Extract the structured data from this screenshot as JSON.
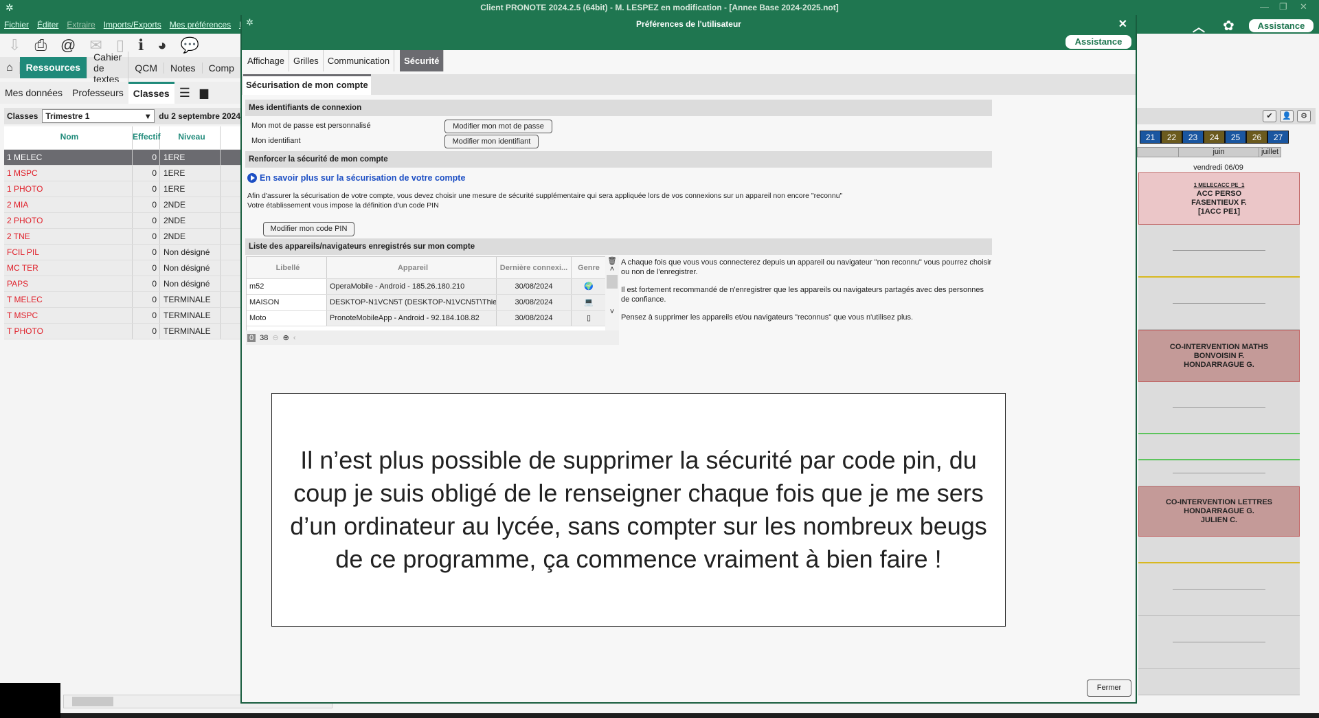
{
  "app": {
    "title": "Client PRONOTE 2024.2.5 (64bit) - M. LESPEZ en modification - [Annee Base 2024-2025.not]",
    "assistance": "Assistance",
    "menu": [
      {
        "label": "Fichier",
        "enabled": true
      },
      {
        "label": "Éditer",
        "enabled": true
      },
      {
        "label": "Extraire",
        "enabled": false
      },
      {
        "label": "Imports/Exports",
        "enabled": true
      },
      {
        "label": "Mes préférences",
        "enabled": true
      },
      {
        "label": "Pa",
        "enabled": true
      }
    ],
    "nav": [
      "Ressources",
      "Cahier de textes",
      "QCM",
      "Notes",
      "Comp"
    ],
    "subtabs": [
      "Mes données",
      "Professeurs",
      "Classes"
    ],
    "filter": {
      "label": "Classes",
      "period": "Trimestre 1",
      "date": "du 2 septembre 2024"
    },
    "class_table": {
      "headers": [
        "Nom",
        "Effectif",
        "Niveau"
      ],
      "rows": [
        [
          "1 MELEC",
          "0",
          "1ERE"
        ],
        [
          "1 MSPC",
          "0",
          "1ERE"
        ],
        [
          "1 PHOTO",
          "0",
          "1ERE"
        ],
        [
          "2 MIA",
          "0",
          "2NDE"
        ],
        [
          "2 PHOTO",
          "0",
          "2NDE"
        ],
        [
          "2 TNE",
          "0",
          "2NDE"
        ],
        [
          "FCIL PIL",
          "0",
          "Non désigné"
        ],
        [
          "MC TER",
          "0",
          "Non désigné"
        ],
        [
          "PAPS",
          "0",
          "Non désigné"
        ],
        [
          "T MELEC",
          "0",
          "TERMINALE"
        ],
        [
          "T MSPC",
          "0",
          "TERMINALE"
        ],
        [
          "T PHOTO",
          "0",
          "TERMINALE"
        ]
      ],
      "selected": 0
    }
  },
  "calendar": {
    "weeks": [
      {
        "n": "21",
        "color": "#1a56a0"
      },
      {
        "n": "22",
        "color": "#6b5a1e"
      },
      {
        "n": "23",
        "color": "#1a56a0"
      },
      {
        "n": "24",
        "color": "#6b5a1e"
      },
      {
        "n": "25",
        "color": "#1a56a0"
      },
      {
        "n": "26",
        "color": "#6b5a1e"
      },
      {
        "n": "27",
        "color": "#1a56a0"
      }
    ],
    "months": [
      "juin",
      "juillet"
    ],
    "day": "vendredi 06/09",
    "courses": [
      {
        "code": "1 MELECACC PE_1",
        "lines": [
          "ACC PERSO",
          "FASENTIEUX F.",
          "[1ACC PE1]"
        ]
      },
      {
        "lines": [
          "CO-INTERVENTION MATHS",
          "BONVOISIN F.",
          "HONDARRAGUE G."
        ]
      },
      {
        "lines": [
          "CO-INTERVENTION LETTRES",
          "HONDARRAGUE G.",
          "JULIEN C."
        ]
      }
    ]
  },
  "dialog": {
    "title": "Préférences de l'utilisateur",
    "assistance": "Assistance",
    "tabs": [
      "Affichage",
      "Grilles",
      "Communication",
      "Sécurité"
    ],
    "active_tab": "Sécurité",
    "section": "Sécurisation de mon compte",
    "identifiants": {
      "title": "Mes identifiants de connexion",
      "password_label": "Mon mot de passe est personnalisé",
      "password_button": "Modifier mon mot de passe",
      "id_label": "Mon identifiant",
      "id_button": "Modifier mon identifiant"
    },
    "renforcer": {
      "title": "Renforcer la sécurité de mon compte",
      "link": "En savoir plus sur la sécurisation de votre compte",
      "text1": "Afin d'assurer la sécurisation de votre compte, vous devez choisir une mesure de sécurité supplémentaire qui sera appliquée lors de vos connexions sur un appareil non encore \"reconnu\"",
      "text2": "Votre établissement vous impose la définition d'un code PIN",
      "pin_button": "Modifier mon code PIN"
    },
    "devices": {
      "title": "Liste des appareils/navigateurs enregistrés sur mon compte",
      "headers": [
        "Libellé",
        "Appareil",
        "Dernière connexi...",
        "Genre"
      ],
      "rows": [
        [
          "m52",
          "OperaMobile - Android - 185.26.180.210",
          "30/08/2024",
          "globe-icon"
        ],
        [
          "MAISON",
          "DESKTOP-N1VCN5T (DESKTOP-N1VCN5T\\Thierry",
          "30/08/2024",
          "laptop-icon"
        ],
        [
          "Moto",
          "PronoteMobileApp - Android - 92.184.108.82",
          "30/08/2024",
          "tablet-icon"
        ]
      ],
      "footer": {
        "selected": "0",
        "total": "38"
      },
      "info": [
        "A chaque fois que vous vous connecterez depuis un appareil ou navigateur \"non reconnu\" vous pourrez choisir ou non de l'enregistrer.",
        "Il est fortement recommandé de n'enregistrer que les appareils ou navigateurs partagés avec des personnes de confiance.",
        "Pensez à supprimer les appareils et/ou navigateurs \"reconnus\" que vous n'utilisez plus."
      ]
    },
    "close_button": "Fermer"
  },
  "annotation": "Il n’est plus possible de supprimer la sécurité par code pin, du coup je suis obligé de le renseigner chaque fois que je me sers d’un ordinateur au lycée, sans compter sur les nombreux beugs de ce programme, ça commence vraiment à bien faire !"
}
